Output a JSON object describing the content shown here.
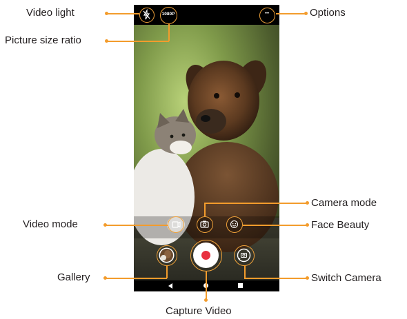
{
  "labels": {
    "video_light": "Video light",
    "picture_size_ratio": "Picture size ratio",
    "options": "Options",
    "camera_mode": "Camera mode",
    "video_mode": "Video mode",
    "face_beauty": "Face Beauty",
    "gallery": "Gallery",
    "switch_camera": "Switch Camera",
    "capture_video": "Capture Video"
  },
  "camera": {
    "resolution_badge": "1080P",
    "options_glyph": "•••"
  },
  "icons": {
    "video_light": "flash-off-icon",
    "picture_size": "resolution-badge",
    "options": "more-dots-icon",
    "video_mode": "video-camera-icon",
    "camera_mode": "camera-icon",
    "face_beauty": "face-icon",
    "gallery": "gallery-thumbnail",
    "capture": "record-icon",
    "switch_camera": "switch-camera-icon",
    "nav_back": "back-triangle-icon",
    "nav_home": "home-dot-icon",
    "nav_recents": "recents-square-icon"
  },
  "colors": {
    "callout": "#f39c2c",
    "record": "#e8303f",
    "text": "#231f20"
  }
}
